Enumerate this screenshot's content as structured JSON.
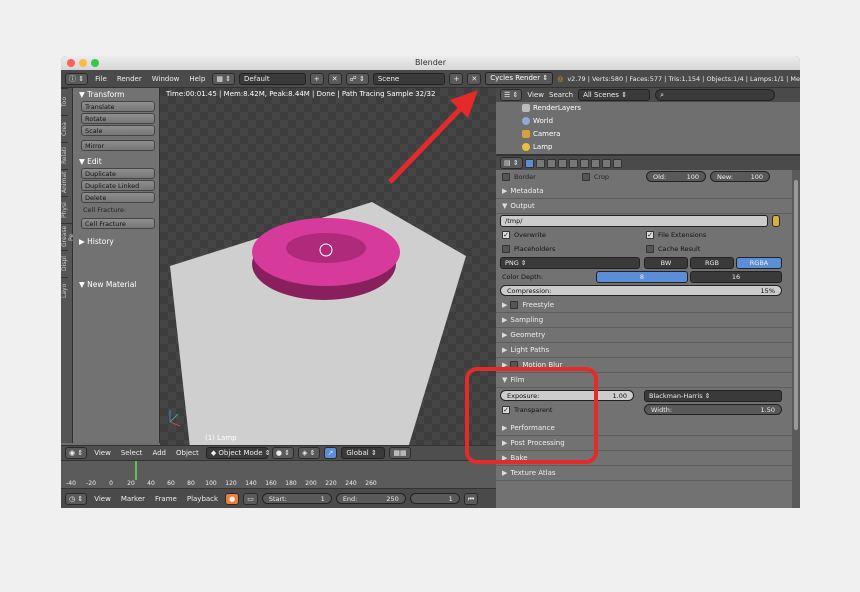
{
  "window": {
    "title": "Blender"
  },
  "topbar": {
    "menus": [
      "File",
      "Render",
      "Window",
      "Help"
    ],
    "layout": "Default",
    "scene": "Scene",
    "engine": "Cycles Render",
    "stats": "v2.79 | Verts:580 | Faces:577 | Tris:1,154 | Objects:1/4 | Lamps:1/1 | Me"
  },
  "tabs": [
    "Too",
    "Crea",
    "Relati",
    "Animat",
    "Physi",
    "Grease Pe",
    "Displ",
    "Layo"
  ],
  "shelf": {
    "transform_title": "Transform",
    "transform": [
      "Translate",
      "Rotate",
      "Scale"
    ],
    "mirror": "Mirror",
    "edit_title": "Edit",
    "edit": [
      "Duplicate",
      "Duplicate Linked",
      "Delete"
    ],
    "cell_label": "Cell Fracture:",
    "cell_btn": "Cell Fracture",
    "history": "History",
    "new_material": "New Material"
  },
  "viewport": {
    "info": "Time:00:01.45 | Mem:8.42M, Peak:8.44M | Done | Path Tracing Sample 32/32",
    "object_label": "(1) Lamp"
  },
  "vp_header": {
    "menus": [
      "View",
      "Select",
      "Add",
      "Object"
    ],
    "mode": "Object Mode",
    "orientation": "Global"
  },
  "timeline": {
    "ticks": [
      "-40",
      "-20",
      "0",
      "20",
      "40",
      "60",
      "80",
      "100",
      "120",
      "140",
      "160",
      "180",
      "200",
      "220",
      "240",
      "260"
    ],
    "menus": [
      "View",
      "Marker",
      "Frame",
      "Playback"
    ],
    "start_label": "Start:",
    "start": "1",
    "end_label": "End:",
    "end": "250",
    "current": "1"
  },
  "outliner": {
    "menus": [
      "View",
      "Search"
    ],
    "filter": "All Scenes",
    "items": [
      "RenderLayers",
      "World",
      "Camera",
      "Lamp"
    ]
  },
  "props": {
    "border": "Border",
    "crop": "Crop",
    "old_label": "Old:",
    "old": "100",
    "new_label": "New:",
    "new": "100",
    "metadata": "Metadata",
    "output": "Output",
    "path": "/tmp/",
    "overwrite": "Overwrite",
    "file_ext": "File Extensions",
    "placeholders": "Placeholders",
    "cache": "Cache Result",
    "format": "PNG",
    "bw": "BW",
    "rgb": "RGB",
    "rgba": "RGBA",
    "depth_label": "Color Depth:",
    "d8": "8",
    "d16": "16",
    "compression_label": "Compression:",
    "compression": "15%",
    "freestyle": "Freestyle",
    "sampling": "Sampling",
    "geometry": "Geometry",
    "light_paths": "Light Paths",
    "motion_blur": "Motion Blur",
    "film": "Film",
    "exposure_label": "Exposure:",
    "exposure": "1.00",
    "filter": "Blackman-Harris",
    "width_label": "Width:",
    "width": "1.50",
    "transparent": "Transparent",
    "performance": "Performance",
    "post": "Post Processing",
    "bake": "Bake",
    "atlas": "Texture Atlas"
  },
  "colors": {
    "torus": "#d63a9a",
    "annotation": "#e52a2a",
    "accent": "#5b8ed6"
  }
}
